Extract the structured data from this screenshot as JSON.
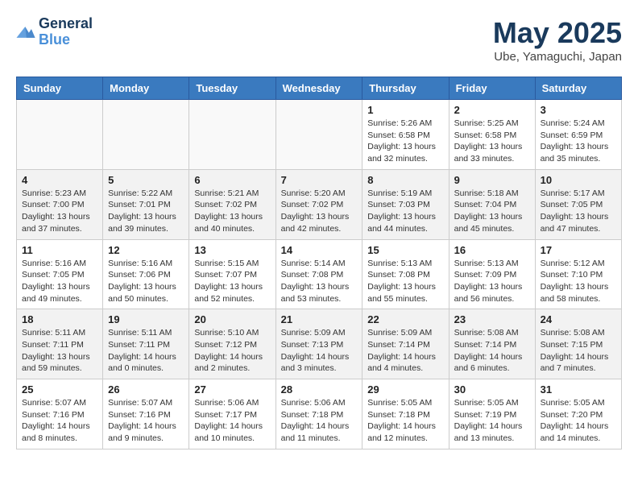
{
  "header": {
    "logo_line1": "General",
    "logo_line2": "Blue",
    "month": "May 2025",
    "location": "Ube, Yamaguchi, Japan"
  },
  "weekdays": [
    "Sunday",
    "Monday",
    "Tuesday",
    "Wednesday",
    "Thursday",
    "Friday",
    "Saturday"
  ],
  "weeks": [
    {
      "days": [
        {
          "num": "",
          "content": ""
        },
        {
          "num": "",
          "content": ""
        },
        {
          "num": "",
          "content": ""
        },
        {
          "num": "",
          "content": ""
        },
        {
          "num": "1",
          "content": "Sunrise: 5:26 AM\nSunset: 6:58 PM\nDaylight: 13 hours\nand 32 minutes."
        },
        {
          "num": "2",
          "content": "Sunrise: 5:25 AM\nSunset: 6:58 PM\nDaylight: 13 hours\nand 33 minutes."
        },
        {
          "num": "3",
          "content": "Sunrise: 5:24 AM\nSunset: 6:59 PM\nDaylight: 13 hours\nand 35 minutes."
        }
      ]
    },
    {
      "days": [
        {
          "num": "4",
          "content": "Sunrise: 5:23 AM\nSunset: 7:00 PM\nDaylight: 13 hours\nand 37 minutes."
        },
        {
          "num": "5",
          "content": "Sunrise: 5:22 AM\nSunset: 7:01 PM\nDaylight: 13 hours\nand 39 minutes."
        },
        {
          "num": "6",
          "content": "Sunrise: 5:21 AM\nSunset: 7:02 PM\nDaylight: 13 hours\nand 40 minutes."
        },
        {
          "num": "7",
          "content": "Sunrise: 5:20 AM\nSunset: 7:02 PM\nDaylight: 13 hours\nand 42 minutes."
        },
        {
          "num": "8",
          "content": "Sunrise: 5:19 AM\nSunset: 7:03 PM\nDaylight: 13 hours\nand 44 minutes."
        },
        {
          "num": "9",
          "content": "Sunrise: 5:18 AM\nSunset: 7:04 PM\nDaylight: 13 hours\nand 45 minutes."
        },
        {
          "num": "10",
          "content": "Sunrise: 5:17 AM\nSunset: 7:05 PM\nDaylight: 13 hours\nand 47 minutes."
        }
      ]
    },
    {
      "days": [
        {
          "num": "11",
          "content": "Sunrise: 5:16 AM\nSunset: 7:05 PM\nDaylight: 13 hours\nand 49 minutes."
        },
        {
          "num": "12",
          "content": "Sunrise: 5:16 AM\nSunset: 7:06 PM\nDaylight: 13 hours\nand 50 minutes."
        },
        {
          "num": "13",
          "content": "Sunrise: 5:15 AM\nSunset: 7:07 PM\nDaylight: 13 hours\nand 52 minutes."
        },
        {
          "num": "14",
          "content": "Sunrise: 5:14 AM\nSunset: 7:08 PM\nDaylight: 13 hours\nand 53 minutes."
        },
        {
          "num": "15",
          "content": "Sunrise: 5:13 AM\nSunset: 7:08 PM\nDaylight: 13 hours\nand 55 minutes."
        },
        {
          "num": "16",
          "content": "Sunrise: 5:13 AM\nSunset: 7:09 PM\nDaylight: 13 hours\nand 56 minutes."
        },
        {
          "num": "17",
          "content": "Sunrise: 5:12 AM\nSunset: 7:10 PM\nDaylight: 13 hours\nand 58 minutes."
        }
      ]
    },
    {
      "days": [
        {
          "num": "18",
          "content": "Sunrise: 5:11 AM\nSunset: 7:11 PM\nDaylight: 13 hours\nand 59 minutes."
        },
        {
          "num": "19",
          "content": "Sunrise: 5:11 AM\nSunset: 7:11 PM\nDaylight: 14 hours\nand 0 minutes."
        },
        {
          "num": "20",
          "content": "Sunrise: 5:10 AM\nSunset: 7:12 PM\nDaylight: 14 hours\nand 2 minutes."
        },
        {
          "num": "21",
          "content": "Sunrise: 5:09 AM\nSunset: 7:13 PM\nDaylight: 14 hours\nand 3 minutes."
        },
        {
          "num": "22",
          "content": "Sunrise: 5:09 AM\nSunset: 7:14 PM\nDaylight: 14 hours\nand 4 minutes."
        },
        {
          "num": "23",
          "content": "Sunrise: 5:08 AM\nSunset: 7:14 PM\nDaylight: 14 hours\nand 6 minutes."
        },
        {
          "num": "24",
          "content": "Sunrise: 5:08 AM\nSunset: 7:15 PM\nDaylight: 14 hours\nand 7 minutes."
        }
      ]
    },
    {
      "days": [
        {
          "num": "25",
          "content": "Sunrise: 5:07 AM\nSunset: 7:16 PM\nDaylight: 14 hours\nand 8 minutes."
        },
        {
          "num": "26",
          "content": "Sunrise: 5:07 AM\nSunset: 7:16 PM\nDaylight: 14 hours\nand 9 minutes."
        },
        {
          "num": "27",
          "content": "Sunrise: 5:06 AM\nSunset: 7:17 PM\nDaylight: 14 hours\nand 10 minutes."
        },
        {
          "num": "28",
          "content": "Sunrise: 5:06 AM\nSunset: 7:18 PM\nDaylight: 14 hours\nand 11 minutes."
        },
        {
          "num": "29",
          "content": "Sunrise: 5:05 AM\nSunset: 7:18 PM\nDaylight: 14 hours\nand 12 minutes."
        },
        {
          "num": "30",
          "content": "Sunrise: 5:05 AM\nSunset: 7:19 PM\nDaylight: 14 hours\nand 13 minutes."
        },
        {
          "num": "31",
          "content": "Sunrise: 5:05 AM\nSunset: 7:20 PM\nDaylight: 14 hours\nand 14 minutes."
        }
      ]
    }
  ]
}
